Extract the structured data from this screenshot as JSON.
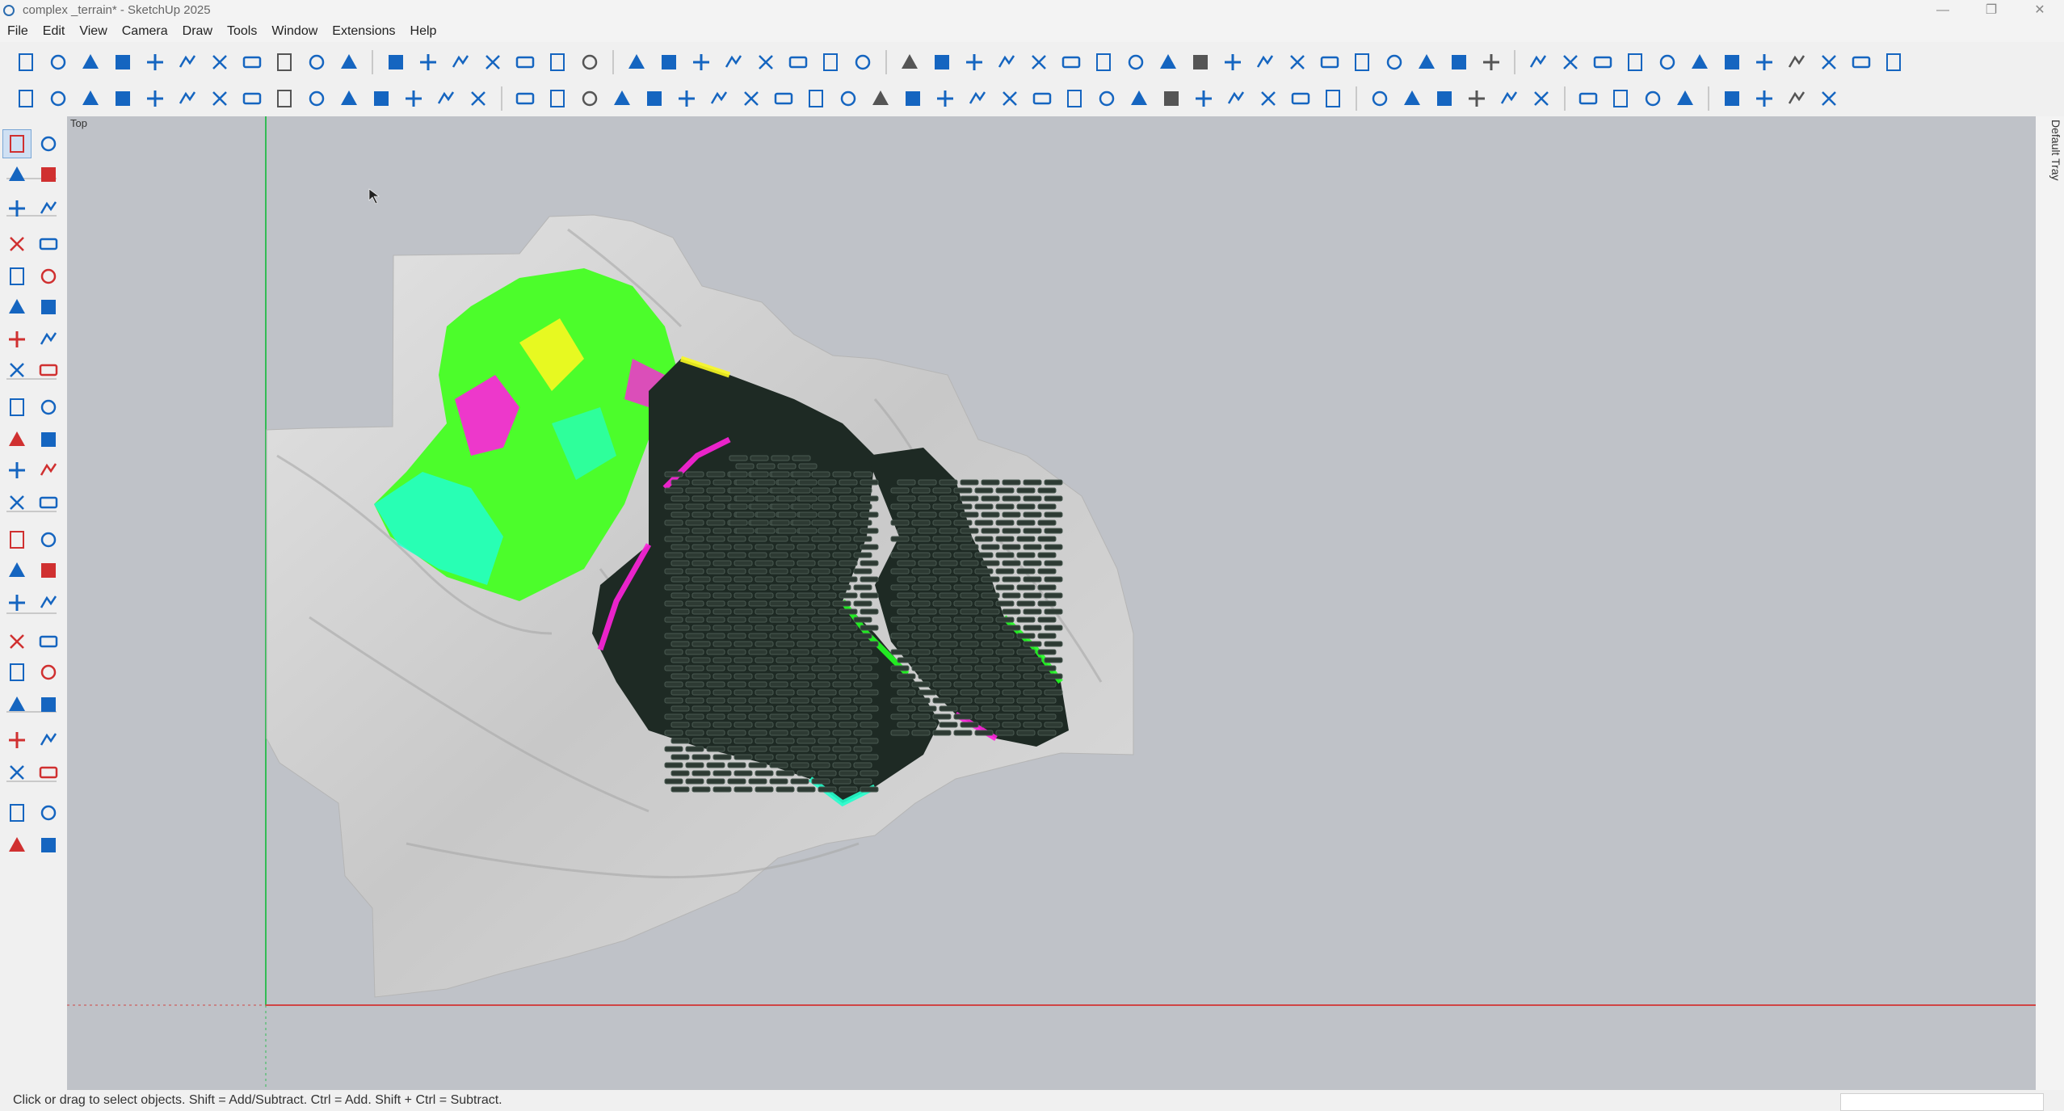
{
  "window": {
    "title": "complex _terrain* - SketchUp 2025",
    "controls": [
      "—",
      "❐",
      "✕"
    ]
  },
  "menu": [
    "File",
    "Edit",
    "View",
    "Camera",
    "Draw",
    "Tools",
    "Window",
    "Extensions",
    "Help"
  ],
  "toolbar_row1": {
    "groups": [
      [
        "new-file-icon",
        "open-file-icon",
        "save-icon",
        "cut-icon",
        "copy-icon",
        "paste-icon",
        "delete-icon",
        "undo-icon",
        "redo-icon",
        "print-icon",
        "model-info-icon"
      ],
      [
        "iso-view-icon",
        "top-view-icon",
        "front-view-icon",
        "right-view-icon",
        "back-view-icon",
        "left-view-icon",
        "bottom-view-icon"
      ],
      [
        "xray-icon",
        "back-edges-icon",
        "wireframe-icon",
        "hidden-line-icon",
        "shaded-icon",
        "shaded-textures-icon",
        "monochrome-icon",
        "monochrome-alt-icon"
      ],
      [
        "zoom-icon",
        "dimension-icon",
        "height-icon",
        "slope-icon",
        "swap-icon",
        "layers-icon",
        "lock-icon",
        "profile-icon",
        "terrain-icon",
        "shading-icon",
        "scene-icon",
        "grid-icon",
        "road-icon",
        "array-icon",
        "expand-icon",
        "auto-icon",
        "arrow-right-icon",
        "tiles-icon",
        "pattern-icon"
      ],
      [
        "house-icon",
        "text-tool-icon",
        "tree-icon",
        "pin-icon",
        "windmill-icon",
        "tower-icon",
        "box-icon",
        "fence-icon",
        "move-plus-icon",
        "scale-icon",
        "hide-icon",
        "triangle-icon"
      ]
    ]
  },
  "toolbar_row2": {
    "groups": [
      [
        "menu-icon",
        "sun-icon",
        "globe-icon",
        "frame-icon",
        "drop-icon",
        "mountain-icon",
        "panel-icon",
        "panel-flat-icon",
        "grid-table-icon",
        "panel-tilt-icon",
        "trash-icon",
        "percent-icon",
        "magic-icon",
        "magic-alt-icon",
        "route-icon"
      ],
      [
        "pattern-grid-icon",
        "tag-icon",
        "dollar-icon",
        "search-plus-icon",
        "cable-icon",
        "search-cable-icon",
        "ground-icon",
        "link-icon",
        "rack-icon",
        "axis-icon",
        "module-icon",
        "hospital-icon",
        "cloud-cad-icon",
        "ruler-icon",
        "tree-branch-icon",
        "chart-icon",
        "flag-icon",
        "crosshair-icon",
        "table-icon",
        "sliders-icon",
        "dropbox-icon",
        "coins-icon",
        "yen-icon",
        "kwh-icon",
        "irr-icon",
        "report-icon"
      ],
      [
        "settings-icon",
        "users-icon",
        "language-icon",
        "help-icon",
        "cloud-upload-icon",
        "refresh-icon"
      ],
      [
        "database-icon",
        "loss-icon",
        "bi-icon",
        "play-icon"
      ],
      [
        "extend-icon",
        "trim-icon",
        "image-icon",
        "document-icon"
      ]
    ]
  },
  "left_tools": [
    [
      "select-icon",
      "lasso-icon"
    ],
    [
      "paint-bucket-icon",
      "eraser-icon"
    ],
    [
      "component-icon",
      "tag-tool-icon"
    ],
    [
      "pencil-icon",
      "freehand-icon"
    ],
    [
      "rectangle-icon",
      "rotated-rectangle-icon"
    ],
    [
      "circle-icon",
      "polygon-icon"
    ],
    [
      "arc-icon",
      "arc-2pt-icon"
    ],
    [
      "pie-icon",
      "arc-3pt-icon"
    ],
    [
      "move-icon",
      "push-pull-icon"
    ],
    [
      "rotate-icon",
      "follow-me-icon"
    ],
    [
      "scale-tool-icon",
      "offset-icon"
    ],
    [
      "axes-icon",
      "section-icon"
    ],
    [
      "tape-measure-icon",
      "protractor-icon"
    ],
    [
      "dimension-tool-icon",
      "label-icon"
    ],
    [
      "axes-tool-icon",
      "3d-text-icon"
    ],
    [
      "section-plane-icon",
      "pan-icon"
    ],
    [
      "zoom-tool-icon",
      "zoom-window-icon"
    ],
    [
      "zoom-extents-icon",
      "previous-view-icon"
    ],
    [
      "position-camera-icon",
      "walk-icon"
    ],
    [
      "look-around-icon",
      "field-of-view-icon"
    ],
    [
      "sandbox-icon",
      "sandbox-contours-icon"
    ],
    [
      "stamp-icon",
      "drape-icon"
    ]
  ],
  "viewport": {
    "scene_label": "Top"
  },
  "tray": {
    "label": "Default Tray"
  },
  "status": {
    "text": "Click or drag to select objects. Shift = Add/Subtract. Ctrl = Add. Shift + Ctrl = Subtract."
  },
  "colors": {
    "accent_blue": "#1565c0",
    "viewport_bg": "#bfc2c8",
    "green_axis": "#33bb55",
    "red_axis": "#d04545",
    "terrain": "#d5d5d5",
    "panel_dark": "#1e2a24",
    "heat_green": "#22ff22",
    "heat_cyan": "#22ffcc",
    "heat_magenta": "#ff22dd",
    "heat_yellow": "#f8f820"
  }
}
